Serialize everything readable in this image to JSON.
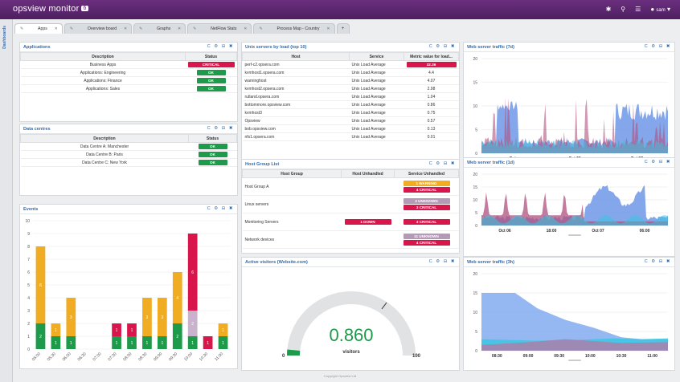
{
  "app": {
    "brand": "opsview monitor",
    "badge": "6",
    "user": "sam",
    "footer": "Copyright Opsview Ltd"
  },
  "topbar_icons": [
    "lightbulb-icon",
    "search-icon",
    "menu-icon",
    "user-icon"
  ],
  "sidebar": {
    "label": "Dashboards"
  },
  "tabs": [
    {
      "label": "Apps",
      "active": true
    },
    {
      "label": "Overview board",
      "active": false
    },
    {
      "label": "Graphs",
      "active": false
    },
    {
      "label": "NetFlow Stats",
      "active": false
    },
    {
      "label": "Process Map - Country",
      "active": false
    }
  ],
  "applications": {
    "title": "Applications",
    "headers": [
      "Description",
      "Status"
    ],
    "rows": [
      {
        "desc": "Business Apps",
        "status": "CRITICAL"
      },
      {
        "desc": "Applications: Engineering",
        "status": "OK"
      },
      {
        "desc": "Applications: Finance",
        "status": "OK"
      },
      {
        "desc": "Applications: Sales",
        "status": "OK"
      }
    ]
  },
  "datacentres": {
    "title": "Data centres",
    "headers": [
      "Description",
      "Status"
    ],
    "rows": [
      {
        "desc": "Data Centre A: Manchester",
        "status": "OK"
      },
      {
        "desc": "Data Centre B: Paris",
        "status": "OK"
      },
      {
        "desc": "Data Centre C: New York",
        "status": "OK"
      }
    ]
  },
  "unix": {
    "title": "Unix servers by load (top 10)",
    "headers": [
      "Host",
      "Service",
      "Metric value for load..."
    ],
    "rows": [
      {
        "host": "perf-c2.opsera.com",
        "service": "Unix Load Average",
        "value": "32.36",
        "critical": true
      },
      {
        "host": "kvmhost1.opsera.com",
        "service": "Unix Load Average",
        "value": "4.4",
        "critical": false
      },
      {
        "host": "warninghost",
        "service": "Unix Load Average",
        "value": "4.07",
        "critical": false
      },
      {
        "host": "kvmhost2.opsera.com",
        "service": "Unix Load Average",
        "value": "2.98",
        "critical": false
      },
      {
        "host": "rutland.opsera.com",
        "service": "Unix Load Average",
        "value": "1.04",
        "critical": false
      },
      {
        "host": "bottommore.opsview.com",
        "service": "Unix Load Average",
        "value": "0.86",
        "critical": false
      },
      {
        "host": "kvmhost3",
        "service": "Unix Load Average",
        "value": "0.75",
        "critical": false
      },
      {
        "host": "Opsview",
        "service": "Unix Load Average",
        "value": "0.57",
        "critical": false
      },
      {
        "host": "bob.opsview.com",
        "service": "Unix Load Average",
        "value": "0.13",
        "critical": false
      },
      {
        "host": "nfs1.opsera.com",
        "service": "Unix Load Average",
        "value": "0.01",
        "critical": false
      }
    ]
  },
  "hostgroup": {
    "title": "Host Group List",
    "headers": [
      "Host Group",
      "Host Unhandled",
      "Service Unhandled"
    ],
    "rows": [
      {
        "name": "Host Group A",
        "host": [],
        "service": [
          {
            "label": "1 WARNING",
            "kind": "warn"
          },
          {
            "label": "4 CRITICAL",
            "kind": "crit"
          }
        ]
      },
      {
        "name": "Linux servers",
        "host": [],
        "service": [
          {
            "label": "2 UNKNOWN",
            "kind": "unk"
          },
          {
            "label": "3 CRITICAL",
            "kind": "crit"
          }
        ]
      },
      {
        "name": "Monitoring Servers",
        "host": [
          {
            "label": "1 DOWN",
            "kind": "crit"
          }
        ],
        "service": [
          {
            "label": "3 CRITICAL",
            "kind": "crit"
          }
        ]
      },
      {
        "name": "Network devices",
        "host": [],
        "service": [
          {
            "label": "11 UNKNOWN",
            "kind": "unk"
          },
          {
            "label": "4 CRITICAL",
            "kind": "crit"
          }
        ]
      }
    ]
  },
  "visitors": {
    "title": "Active visitors (Website.com)",
    "value": "0.860",
    "unit": "visitors",
    "min": "0",
    "max": "100",
    "level": 0.0086
  },
  "panel_controls": "C ⚙ ⊟ ✖",
  "colors": {
    "ok": "#1d9a4a",
    "critical": "#d8164c",
    "warning": "#f0ad23",
    "unknown": "#b59ab8",
    "accent": "#2f6db5",
    "brand": "#5a2570"
  },
  "chart_data": [
    {
      "name": "Events",
      "title": "Events",
      "type": "bar",
      "stacked": true,
      "categories": [
        "05:00",
        "05:30",
        "06:00",
        "06:30",
        "07:00",
        "07:30",
        "08:00",
        "08:30",
        "09:00",
        "09:30",
        "10:00",
        "10:30",
        "11:00"
      ],
      "ylim": [
        0,
        10
      ],
      "yticks": [
        "0",
        "1",
        "2",
        "3",
        "4",
        "5",
        "6",
        "7",
        "8",
        "9",
        "10"
      ],
      "series": [
        {
          "color": "#1d9a4a",
          "values": [
            2,
            1,
            1,
            0,
            0,
            1,
            1,
            1,
            1,
            2,
            1,
            0,
            1
          ]
        },
        {
          "color": "#f0ad23",
          "values": [
            6,
            1,
            3,
            0,
            0,
            0,
            0,
            3,
            3,
            4,
            0,
            0,
            1
          ]
        },
        {
          "color": "#c9b2cb",
          "values": [
            0,
            0,
            0,
            0,
            0,
            0,
            0,
            0,
            0,
            0,
            2,
            0,
            0
          ]
        },
        {
          "color": "#d8164c",
          "values": [
            0,
            0,
            0,
            0,
            0,
            1,
            1,
            0,
            0,
            0,
            6,
            1,
            0
          ]
        }
      ],
      "labels": [
        [
          2,
          1,
          1,
          null,
          null,
          1,
          1,
          1,
          1,
          2,
          1,
          null,
          1
        ],
        [
          6,
          1,
          3,
          null,
          null,
          null,
          null,
          3,
          3,
          4,
          null,
          null,
          1
        ],
        [
          null,
          null,
          null,
          null,
          null,
          null,
          null,
          null,
          null,
          null,
          2,
          null,
          null
        ],
        [
          null,
          null,
          null,
          null,
          null,
          1,
          1,
          null,
          null,
          null,
          6,
          1,
          null
        ]
      ]
    },
    {
      "name": "Web server traffic (7d)",
      "title": "Web server traffic (7d)",
      "type": "area",
      "ylim": [
        0,
        20
      ],
      "yticks": [
        "0",
        "5",
        "10",
        "15",
        "20"
      ],
      "xticks": [
        "Oct",
        "Oct 05",
        "Oct 07"
      ]
    },
    {
      "name": "Web server traffic (1d)",
      "title": "Web server traffic (1d)",
      "type": "area",
      "ylim": [
        0,
        20
      ],
      "yticks": [
        "0",
        "5",
        "10",
        "15",
        "20"
      ],
      "xticks": [
        "Oct 06",
        "18:00",
        "Oct 07",
        "06:00"
      ]
    },
    {
      "name": "Web server traffic (3h)",
      "title": "Web server traffic (3h)",
      "type": "area",
      "ylim": [
        0,
        20
      ],
      "yticks": [
        "0",
        "5",
        "10",
        "15",
        "20"
      ],
      "xticks": [
        "08:30",
        "09:00",
        "09:30",
        "10:00",
        "10:30",
        "11:00"
      ],
      "series": [
        {
          "color": "#7aa6ef",
          "x": [
            0,
            0.18,
            0.3,
            0.45,
            0.6,
            0.75,
            0.86,
            1
          ],
          "y": [
            15,
            15,
            11,
            8,
            6,
            3.5,
            3,
            3
          ]
        },
        {
          "color": "#37c7e0",
          "x": [
            0,
            0.3,
            0.5,
            0.7,
            0.86,
            1
          ],
          "y": [
            3,
            2.6,
            2.8,
            3.2,
            3,
            3.2
          ]
        },
        {
          "color": "#b07aa8",
          "x": [
            0,
            0.25,
            0.45,
            0.6,
            0.75,
            1
          ],
          "y": [
            1.5,
            2.2,
            3,
            2.5,
            2,
            2.2
          ]
        }
      ]
    }
  ]
}
